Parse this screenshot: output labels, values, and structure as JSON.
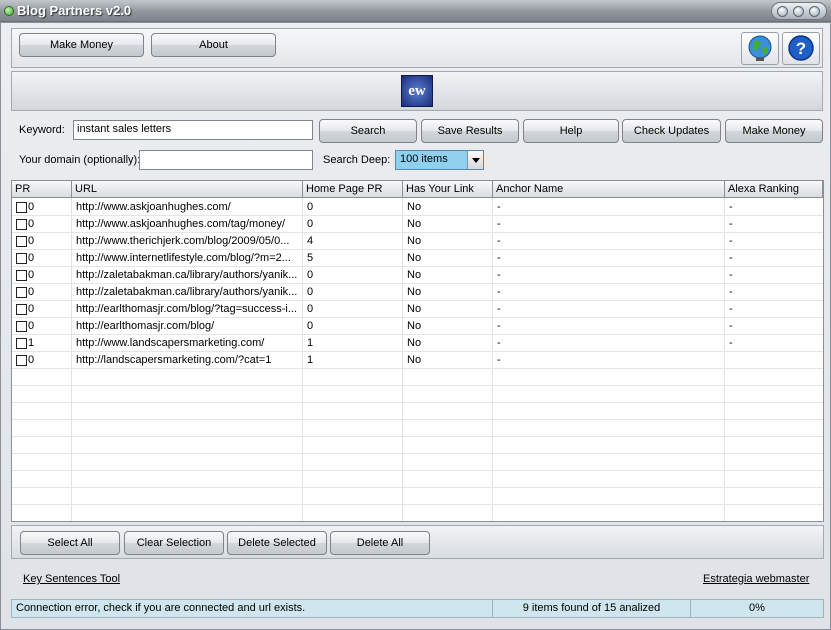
{
  "window": {
    "title": "Blog Partners v2.0"
  },
  "toolbar": {
    "make_money": "Make Money",
    "about": "About"
  },
  "banner": {
    "logo_text": "ew"
  },
  "search": {
    "keyword_label": "Keyword:",
    "keyword_value": "instant sales letters",
    "domain_label": "Your domain (optionally):",
    "domain_value": "",
    "deep_label": "Search Deep:",
    "deep_value": "100 items"
  },
  "actions": {
    "search": "Search",
    "save_results": "Save Results",
    "help": "Help",
    "check_updates": "Check Updates",
    "make_money": "Make Money"
  },
  "table": {
    "headers": [
      "PR",
      "URL",
      "Home Page PR",
      "Has Your Link",
      "Anchor Name",
      "Alexa Ranking"
    ],
    "rows": [
      {
        "pr": "0",
        "url": "http://www.askjoanhughes.com/",
        "hpr": "0",
        "link": "No",
        "anchor": "-",
        "alexa": "-"
      },
      {
        "pr": "0",
        "url": "http://www.askjoanhughes.com/tag/money/",
        "hpr": "0",
        "link": "No",
        "anchor": "-",
        "alexa": "-"
      },
      {
        "pr": "0",
        "url": "http://www.therichjerk.com/blog/2009/05/0...",
        "hpr": "4",
        "link": "No",
        "anchor": "-",
        "alexa": "-"
      },
      {
        "pr": "0",
        "url": "http://www.internetlifestyle.com/blog/?m=2...",
        "hpr": "5",
        "link": "No",
        "anchor": "-",
        "alexa": "-"
      },
      {
        "pr": "0",
        "url": "http://zaletabakman.ca/library/authors/yanik...",
        "hpr": "0",
        "link": "No",
        "anchor": "-",
        "alexa": "-"
      },
      {
        "pr": "0",
        "url": "http://zaletabakman.ca/library/authors/yanik...",
        "hpr": "0",
        "link": "No",
        "anchor": "-",
        "alexa": "-"
      },
      {
        "pr": "0",
        "url": "http://earlthomasjr.com/blog/?tag=success-i...",
        "hpr": "0",
        "link": "No",
        "anchor": "-",
        "alexa": "-"
      },
      {
        "pr": "0",
        "url": "http://earlthomasjr.com/blog/",
        "hpr": "0",
        "link": "No",
        "anchor": "-",
        "alexa": "-"
      },
      {
        "pr": "1",
        "url": "http://www.landscapersmarketing.com/",
        "hpr": "1",
        "link": "No",
        "anchor": "-",
        "alexa": "-"
      },
      {
        "pr": "0",
        "url": "http://landscapersmarketing.com/?cat=1",
        "hpr": "1",
        "link": "No",
        "anchor": "-",
        "alexa": ""
      }
    ]
  },
  "bottom": {
    "select_all": "Select All",
    "clear_selection": "Clear Selection",
    "delete_selected": "Delete Selected",
    "delete_all": "Delete All"
  },
  "links": {
    "key_sentences": "Key Sentences Tool",
    "estrategia": "Estrategia webmaster"
  },
  "status": {
    "message": "Connection error, check if you are connected and url exists.",
    "found": "9 items found of 15 analized",
    "progress": "0%"
  }
}
